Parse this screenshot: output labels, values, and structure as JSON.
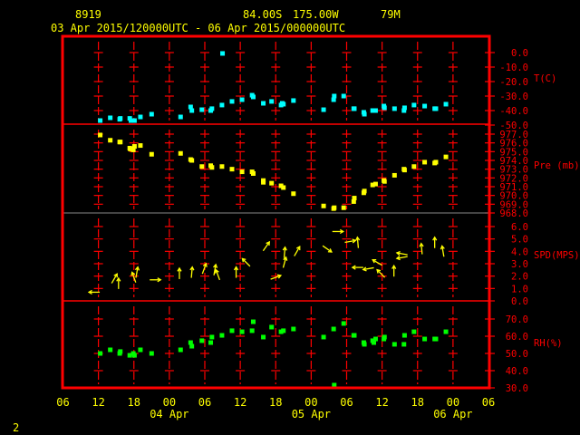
{
  "header": {
    "station": "8919",
    "lat": "84.00S",
    "lon": "175.00W",
    "elev": "79M",
    "range": "03 Apr 2015/120000UTC - 06 Apr 2015/000000UTC"
  },
  "footer": {
    "page": "2"
  },
  "x_axis": {
    "time_origin": "03 Apr 2015 06UTC",
    "hour_range": [
      0,
      72
    ],
    "tick_labels": [
      "06",
      "12",
      "18",
      "00",
      "06",
      "12",
      "18",
      "00",
      "06",
      "12",
      "18",
      "00",
      "06"
    ],
    "date_labels": [
      {
        "label": "04 Apr",
        "hour": 18
      },
      {
        "label": "05 Apr",
        "hour": 42
      },
      {
        "label": "06 Apr",
        "hour": 66
      }
    ]
  },
  "colors": {
    "frame": "#ff0000",
    "temp": "#00ffff",
    "pressure": "#ffff00",
    "wind": "#ffff00",
    "rh": "#00ff00",
    "text": "#ffff00"
  },
  "chart_data": [
    {
      "type": "scatter",
      "name": "temperature",
      "ylabel": "T(C)",
      "ylim": [
        -50,
        0
      ],
      "tick_labels": [
        "0.0",
        "-10.0",
        "-20.0",
        "-30.0",
        "-40.0",
        "-50.0"
      ],
      "ticks": [
        0,
        -10,
        -20,
        -30,
        -40,
        -50
      ],
      "points": [
        [
          6.3,
          -46.9
        ],
        [
          8.0,
          -45.0
        ],
        [
          9.6,
          -46.0
        ],
        [
          9.7,
          -45.4
        ],
        [
          11.3,
          -45.4
        ],
        [
          11.5,
          -46.9
        ],
        [
          12.1,
          -46.9
        ],
        [
          13.1,
          -44.4
        ],
        [
          15.0,
          -42.5
        ],
        [
          19.9,
          -44.4
        ],
        [
          21.6,
          -37.5
        ],
        [
          21.8,
          -40.0
        ],
        [
          23.5,
          -39.4
        ],
        [
          25.0,
          -40.0
        ],
        [
          25.2,
          -38.7
        ],
        [
          26.9,
          -36.2
        ],
        [
          27.0,
          -0.6
        ],
        [
          28.6,
          -33.7
        ],
        [
          30.3,
          -32.5
        ],
        [
          32.0,
          -29.4
        ],
        [
          32.2,
          -30.6
        ],
        [
          33.9,
          -35.0
        ],
        [
          35.3,
          -33.7
        ],
        [
          36.9,
          -36.2
        ],
        [
          37.1,
          -35.0
        ],
        [
          37.3,
          -35.6
        ],
        [
          39.0,
          -33.1
        ],
        [
          44.1,
          -39.4
        ],
        [
          45.8,
          -32.5
        ],
        [
          45.9,
          -30.0
        ],
        [
          47.5,
          -30.0
        ],
        [
          49.2,
          -38.7
        ],
        [
          49.3,
          -38.7
        ],
        [
          50.9,
          -41.2
        ],
        [
          51.0,
          -42.5
        ],
        [
          52.4,
          -40.0
        ],
        [
          52.9,
          -40.0
        ],
        [
          54.3,
          -36.9
        ],
        [
          54.4,
          -38.1
        ],
        [
          56.1,
          -38.7
        ],
        [
          57.7,
          -40.0
        ],
        [
          57.8,
          -38.1
        ],
        [
          59.4,
          -36.2
        ],
        [
          61.2,
          -36.9
        ],
        [
          62.9,
          -38.7
        ],
        [
          63.1,
          -38.7
        ],
        [
          64.8,
          -35.6
        ]
      ]
    },
    {
      "type": "scatter",
      "name": "pressure",
      "ylabel": "Pre (mb)",
      "ylim": [
        968,
        977
      ],
      "tick_labels": [
        "977.0",
        "976.0",
        "975.0",
        "974.0",
        "973.0",
        "972.0",
        "971.0",
        "970.0",
        "969.0",
        "968.0"
      ],
      "ticks": [
        977,
        976,
        975,
        974,
        973,
        972,
        971,
        970,
        969,
        968
      ],
      "points": [
        [
          6.3,
          976.9
        ],
        [
          8.0,
          976.3
        ],
        [
          9.6,
          976.1
        ],
        [
          9.7,
          976.1
        ],
        [
          11.3,
          975.4
        ],
        [
          11.4,
          975.3
        ],
        [
          11.9,
          975.2
        ],
        [
          12.1,
          975.6
        ],
        [
          13.1,
          975.7
        ],
        [
          15.0,
          974.7
        ],
        [
          19.9,
          974.8
        ],
        [
          21.6,
          974.1
        ],
        [
          21.8,
          974.0
        ],
        [
          23.5,
          973.3
        ],
        [
          25.0,
          973.4
        ],
        [
          25.2,
          973.2
        ],
        [
          26.9,
          973.3
        ],
        [
          28.6,
          973.0
        ],
        [
          30.3,
          972.7
        ],
        [
          32.0,
          972.7
        ],
        [
          32.2,
          972.5
        ],
        [
          33.9,
          971.7
        ],
        [
          33.9,
          971.5
        ],
        [
          35.3,
          971.4
        ],
        [
          36.9,
          971.1
        ],
        [
          37.3,
          970.9
        ],
        [
          39.0,
          970.2
        ],
        [
          44.1,
          968.8
        ],
        [
          45.8,
          968.5
        ],
        [
          45.9,
          968.6
        ],
        [
          47.5,
          968.6
        ],
        [
          49.2,
          969.3
        ],
        [
          49.3,
          969.7
        ],
        [
          50.9,
          970.3
        ],
        [
          51.0,
          970.5
        ],
        [
          52.4,
          971.2
        ],
        [
          52.9,
          971.3
        ],
        [
          54.3,
          971.7
        ],
        [
          54.4,
          971.6
        ],
        [
          56.1,
          972.3
        ],
        [
          57.7,
          973.0
        ],
        [
          57.8,
          972.9
        ],
        [
          59.4,
          973.3
        ],
        [
          61.2,
          973.8
        ],
        [
          62.9,
          973.7
        ],
        [
          63.1,
          973.8
        ],
        [
          64.8,
          974.4
        ]
      ]
    },
    {
      "type": "scatter",
      "name": "wind",
      "ylabel": "SPD(MPS)",
      "ylim": [
        0,
        6
      ],
      "tick_labels": [
        "6.0",
        "5.0",
        "4.0",
        "3.0",
        "2.0",
        "1.0",
        "0.0"
      ],
      "ticks": [
        6,
        5,
        4,
        3,
        2,
        1,
        0
      ],
      "arrows_hour_speed_dir": [
        [
          5.3,
          0.7,
          270
        ],
        [
          8.7,
          1.8,
          30
        ],
        [
          9.4,
          1.4,
          0
        ],
        [
          12.0,
          1.9,
          340
        ],
        [
          12.5,
          2.3,
          10
        ],
        [
          15.6,
          1.7,
          90
        ],
        [
          19.7,
          2.2,
          0
        ],
        [
          21.8,
          2.3,
          5
        ],
        [
          23.9,
          2.6,
          20
        ],
        [
          25.7,
          2.5,
          10
        ],
        [
          26.2,
          2.1,
          340
        ],
        [
          29.3,
          2.3,
          0
        ],
        [
          31.0,
          3.1,
          315
        ],
        [
          34.4,
          4.4,
          35
        ],
        [
          36.0,
          1.9,
          70
        ],
        [
          37.5,
          3.9,
          5
        ],
        [
          37.5,
          3.1,
          15
        ],
        [
          39.6,
          4.0,
          30
        ],
        [
          44.7,
          4.2,
          125
        ],
        [
          46.5,
          5.6,
          90
        ],
        [
          48.6,
          4.8,
          80
        ],
        [
          49.9,
          4.7,
          355
        ],
        [
          49.9,
          2.7,
          270
        ],
        [
          51.7,
          2.6,
          260
        ],
        [
          53.2,
          3.1,
          300
        ],
        [
          53.8,
          2.2,
          315
        ],
        [
          56.0,
          2.4,
          0
        ],
        [
          57.4,
          3.8,
          280
        ],
        [
          57.4,
          3.5,
          260
        ],
        [
          60.7,
          4.2,
          355
        ],
        [
          62.9,
          4.7,
          0
        ],
        [
          64.3,
          4.0,
          350
        ]
      ]
    },
    {
      "type": "scatter",
      "name": "relative-humidity",
      "ylabel": "RH(%)",
      "ylim": [
        30,
        70
      ],
      "tick_labels": [
        "70.0",
        "60.0",
        "50.0",
        "40.0",
        "30.0"
      ],
      "ticks": [
        70,
        60,
        50,
        40,
        30
      ],
      "points": [
        [
          6.3,
          50.0
        ],
        [
          8.0,
          52.1
        ],
        [
          9.6,
          50.0
        ],
        [
          9.7,
          51.1
        ],
        [
          11.3,
          48.9
        ],
        [
          11.9,
          50.0
        ],
        [
          12.1,
          48.9
        ],
        [
          13.1,
          52.1
        ],
        [
          15.0,
          50.0
        ],
        [
          19.9,
          52.1
        ],
        [
          21.6,
          56.3
        ],
        [
          21.8,
          54.2
        ],
        [
          23.5,
          57.4
        ],
        [
          25.0,
          56.3
        ],
        [
          25.2,
          59.5
        ],
        [
          26.9,
          60.5
        ],
        [
          28.6,
          63.2
        ],
        [
          30.3,
          62.6
        ],
        [
          32.0,
          63.2
        ],
        [
          32.2,
          68.4
        ],
        [
          33.9,
          59.5
        ],
        [
          35.3,
          65.3
        ],
        [
          36.9,
          62.6
        ],
        [
          37.3,
          63.2
        ],
        [
          39.0,
          64.2
        ],
        [
          44.1,
          59.5
        ],
        [
          45.8,
          64.2
        ],
        [
          45.9,
          31.6
        ],
        [
          47.5,
          67.4
        ],
        [
          49.2,
          60.5
        ],
        [
          49.3,
          60.5
        ],
        [
          50.9,
          56.3
        ],
        [
          51.0,
          55.3
        ],
        [
          52.4,
          57.4
        ],
        [
          52.6,
          56.3
        ],
        [
          52.9,
          58.4
        ],
        [
          54.3,
          58.4
        ],
        [
          54.4,
          59.5
        ],
        [
          56.1,
          55.3
        ],
        [
          57.7,
          55.3
        ],
        [
          57.8,
          60.5
        ],
        [
          59.4,
          62.6
        ],
        [
          61.2,
          58.4
        ],
        [
          62.9,
          58.4
        ],
        [
          63.1,
          58.4
        ],
        [
          64.8,
          62.6
        ]
      ]
    }
  ]
}
